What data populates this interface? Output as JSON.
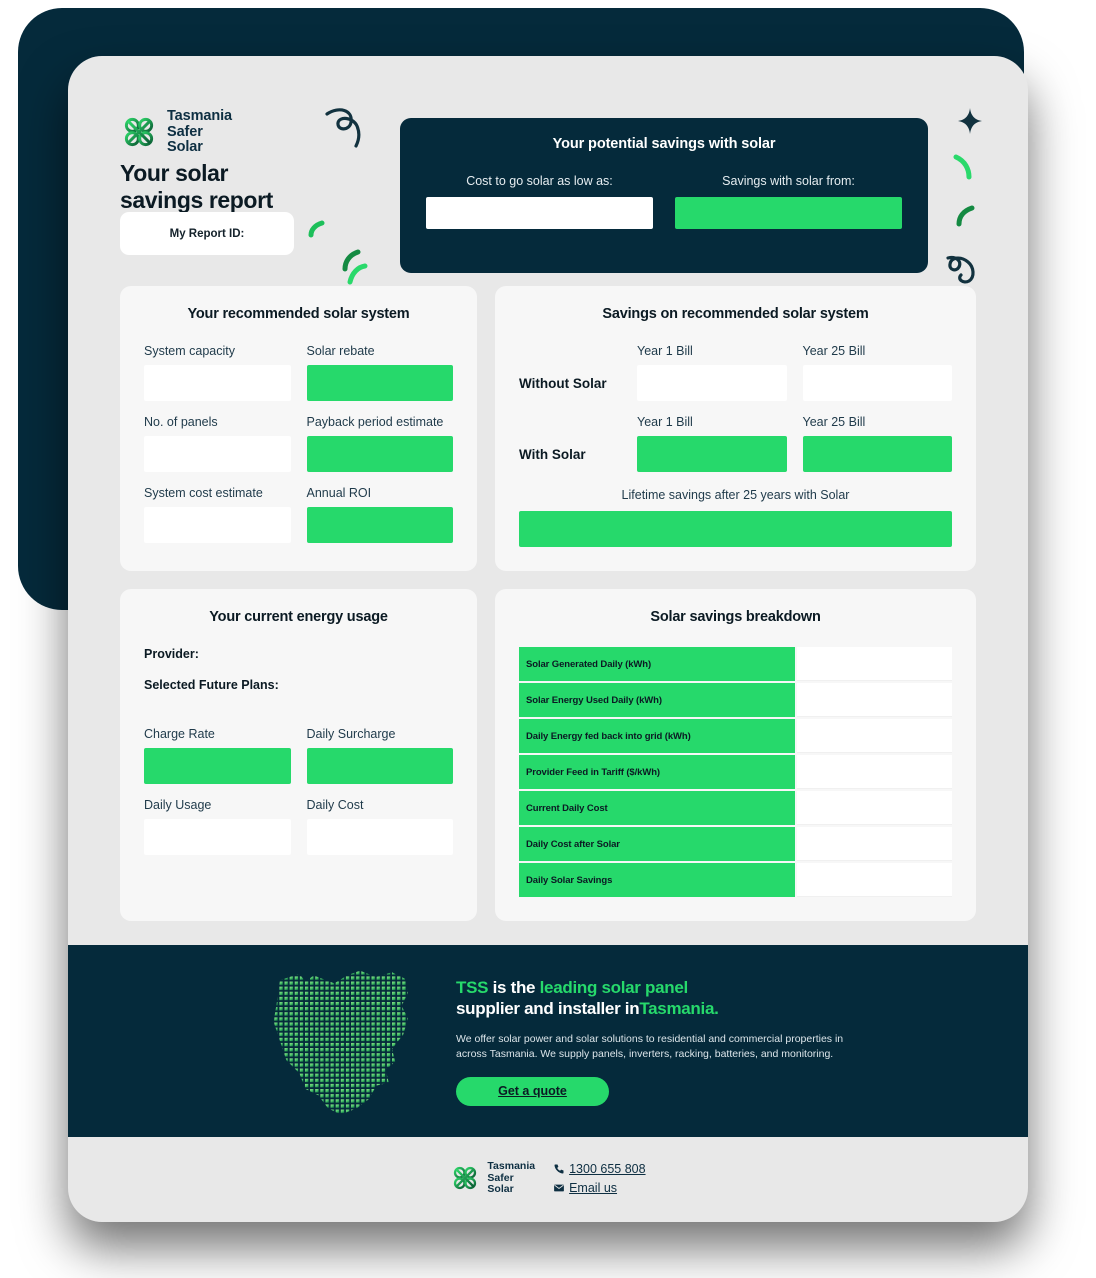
{
  "brand": {
    "name_lines": [
      "Tasmania",
      "Safer",
      "Solar"
    ],
    "mark_icon": "celtic-knot-logo-icon"
  },
  "header": {
    "report_title_line1": "Your solar",
    "report_title_line2": "savings report",
    "report_id_label": "My Report ID:",
    "report_id_value": ""
  },
  "hero": {
    "title": "Your potential savings with solar",
    "cost_label": "Cost to go solar as low as:",
    "cost_value": "",
    "savings_label": "Savings with solar from:",
    "savings_value": ""
  },
  "recommended_system": {
    "title": "Your recommended solar system",
    "fields": [
      {
        "label": "System capacity",
        "value": "",
        "style": "white"
      },
      {
        "label": "Solar rebate",
        "value": "",
        "style": "green"
      },
      {
        "label": "No. of panels",
        "value": "",
        "style": "white"
      },
      {
        "label": "Payback period estimate",
        "value": "",
        "style": "green"
      },
      {
        "label": "System cost estimate",
        "value": "",
        "style": "white"
      },
      {
        "label": "Annual ROI",
        "value": "",
        "style": "green"
      }
    ]
  },
  "savings_panel": {
    "title": "Savings on recommended solar system",
    "col1_header": "Year 1 Bill",
    "col2_header": "Year 25 Bill",
    "row_without_label": "Without Solar",
    "row_without_col1": "",
    "row_without_col2": "",
    "row_with_label": "With Solar",
    "row_with_col1": "",
    "row_with_col2": "",
    "lifetime_label": "Lifetime savings after 25 years with Solar",
    "lifetime_value": ""
  },
  "energy_usage": {
    "title": "Your current energy usage",
    "provider_label": "Provider:",
    "provider_value": "",
    "plans_label": "Selected Future Plans:",
    "plans_value": "",
    "fields": [
      {
        "label": "Charge Rate",
        "value": "",
        "style": "green"
      },
      {
        "label": "Daily Surcharge",
        "value": "",
        "style": "green"
      },
      {
        "label": "Daily Usage",
        "value": "",
        "style": "white"
      },
      {
        "label": "Daily Cost",
        "value": "",
        "style": "white"
      }
    ]
  },
  "breakdown": {
    "title": "Solar savings breakdown",
    "rows": [
      {
        "label": "Solar Generated Daily (kWh)",
        "value": ""
      },
      {
        "label": "Solar Energy Used Daily (kWh)",
        "value": ""
      },
      {
        "label": "Daily Energy fed back into grid (kWh)",
        "value": ""
      },
      {
        "label": "Provider Feed in Tariff ($/kWh)",
        "value": ""
      },
      {
        "label": "Current Daily Cost",
        "value": ""
      },
      {
        "label": "Daily Cost after Solar",
        "value": ""
      },
      {
        "label": "Daily Solar Savings",
        "value": ""
      }
    ]
  },
  "cta": {
    "map_icon": "tasmania-map-icon",
    "head_tss": "TSS",
    "head_part1": " is the ",
    "head_accent1": "leading solar panel",
    "head_part2": "supplier and installer in",
    "head_accent2": "Tasmania.",
    "body": "We offer solar power and solar solutions to residential and commercial properties in across Tasmania. We supply panels, inverters, racking, batteries, and monitoring.",
    "button_label": "Get a quote"
  },
  "footer": {
    "phone": "1300 655 808",
    "phone_icon": "phone-icon",
    "email_label": "Email us",
    "email_icon": "envelope-icon"
  },
  "colors": {
    "navy": "#052A3B",
    "green": "#26D96B",
    "card_bg": "#E8E8E8",
    "panel_bg": "#F7F7F7"
  }
}
